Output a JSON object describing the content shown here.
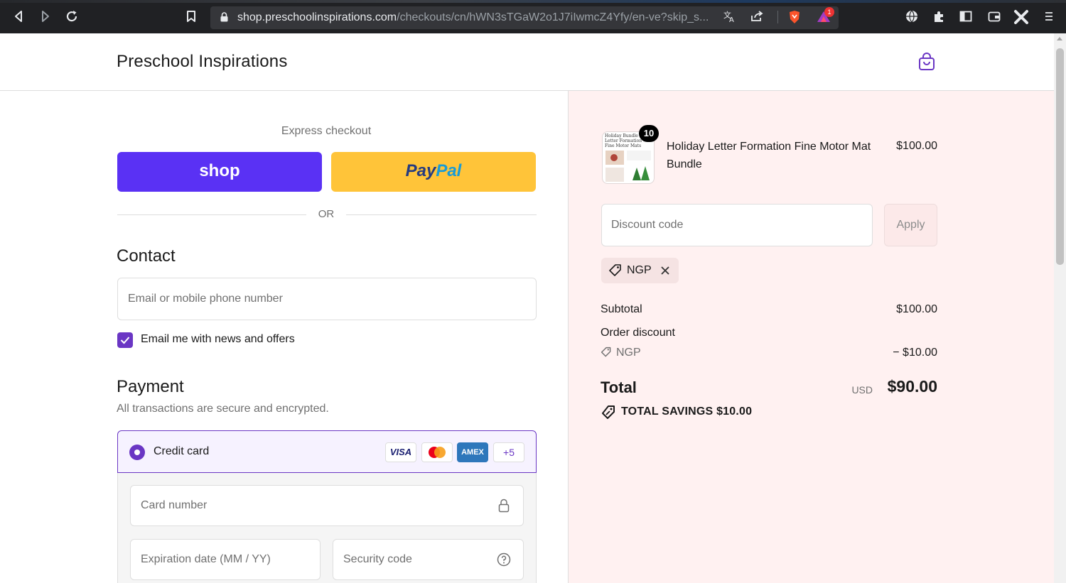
{
  "browser": {
    "url_host": "shop.preschoolinspirations.com",
    "url_path": "/checkouts/cn/hWN3sTGaW2o1J7iIwmcZ4Yfy/en-ve?skip_s...",
    "notification_count": "1"
  },
  "header": {
    "store_name": "Preschool Inspirations"
  },
  "express": {
    "label": "Express checkout",
    "shop_label": "shop",
    "paypal_pay": "Pay",
    "paypal_pal": "Pal",
    "or_label": "OR"
  },
  "contact": {
    "title": "Contact",
    "email_placeholder": "Email or mobile phone number",
    "newsletter_label": "Email me with news and offers",
    "newsletter_checked": true
  },
  "payment": {
    "title": "Payment",
    "subtitle": "All transactions are secure and encrypted.",
    "method_label": "Credit card",
    "card_brands": [
      "VISA",
      "",
      "AMEX",
      "+5"
    ],
    "card_number_placeholder": "Card number",
    "expiry_placeholder": "Expiration date (MM / YY)",
    "security_placeholder": "Security code"
  },
  "summary": {
    "item": {
      "name": "Holiday Letter Formation Fine Motor Mat Bundle",
      "price": "$100.00",
      "quantity": "10",
      "thumb_text": [
        "Holiday Bundle",
        "Letter Formation",
        "Fine Motor Mats"
      ]
    },
    "discount_placeholder": "Discount code",
    "apply_label": "Apply",
    "applied_code": "NGP",
    "subtotal_label": "Subtotal",
    "subtotal_value": "$100.00",
    "order_discount_label": "Order discount",
    "discount_code": "NGP",
    "discount_value": "− $10.00",
    "total_label": "Total",
    "currency": "USD",
    "total_value": "$90.00",
    "savings_label": "TOTAL SAVINGS  $10.00"
  },
  "colors": {
    "brand_purple": "#6a36c4",
    "shop_pay": "#5a31f4",
    "paypal_yellow": "#ffc439",
    "summary_bg": "#fff1f1"
  }
}
